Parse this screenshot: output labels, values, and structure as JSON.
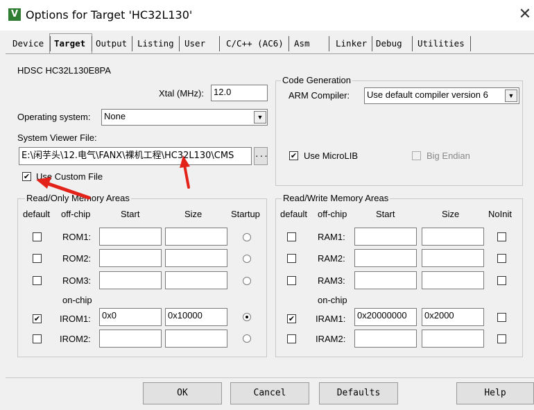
{
  "window": {
    "title": "Options for Target 'HC32L130'",
    "icon": "keil-v-icon",
    "close": "✕"
  },
  "tabs": [
    "Device",
    "Target",
    "Output",
    "Listing",
    "User",
    "C/C++ (AC6)",
    "Asm",
    "Linker",
    "Debug",
    "Utilities"
  ],
  "active_tab": "Target",
  "target": {
    "device_name": "HDSC HC32L130E8PA",
    "xtal_label": "Xtal (MHz):",
    "xtal_value": "12.0",
    "os_label": "Operating system:",
    "os_value": "None",
    "svf_label": "System Viewer File:",
    "svf_value": "E:\\闲芋头\\12.电气\\FANX\\裸机工程\\HC32L130\\CMS",
    "browse_label": "...",
    "use_custom_label": "Use Custom File",
    "use_custom_checked": true
  },
  "codegen": {
    "legend": "Code Generation",
    "compiler_label": "ARM Compiler:",
    "compiler_value": "Use default compiler version 6",
    "microlib_label": "Use MicroLIB",
    "microlib_checked": true,
    "bigendian_label": "Big Endian",
    "bigendian_checked": false
  },
  "rom": {
    "legend": "Read/Only Memory Areas",
    "headers": {
      "default": "default",
      "offchip": "off-chip",
      "start": "Start",
      "size": "Size",
      "startup": "Startup"
    },
    "onchip_label": "on-chip",
    "rows": [
      {
        "label": "ROM1:",
        "start": "",
        "size": "",
        "default": false,
        "startup": false
      },
      {
        "label": "ROM2:",
        "start": "",
        "size": "",
        "default": false,
        "startup": false
      },
      {
        "label": "ROM3:",
        "start": "",
        "size": "",
        "default": false,
        "startup": false
      },
      {
        "label": "IROM1:",
        "start": "0x0",
        "size": "0x10000",
        "default": true,
        "startup": true
      },
      {
        "label": "IROM2:",
        "start": "",
        "size": "",
        "default": false,
        "startup": false
      }
    ]
  },
  "ram": {
    "legend": "Read/Write Memory Areas",
    "headers": {
      "default": "default",
      "offchip": "off-chip",
      "start": "Start",
      "size": "Size",
      "noinit": "NoInit"
    },
    "onchip_label": "on-chip",
    "rows": [
      {
        "label": "RAM1:",
        "start": "",
        "size": "",
        "default": false,
        "noinit": false
      },
      {
        "label": "RAM2:",
        "start": "",
        "size": "",
        "default": false,
        "noinit": false
      },
      {
        "label": "RAM3:",
        "start": "",
        "size": "",
        "default": false,
        "noinit": false
      },
      {
        "label": "IRAM1:",
        "start": "0x20000000",
        "size": "0x2000",
        "default": true,
        "noinit": false
      },
      {
        "label": "IRAM2:",
        "start": "",
        "size": "",
        "default": false,
        "noinit": false
      }
    ]
  },
  "buttons": {
    "ok": "OK",
    "cancel": "Cancel",
    "defaults": "Defaults",
    "help": "Help"
  },
  "glyphs": {
    "check": "✔",
    "dropdown": "▼"
  },
  "annotation_color": "#e3231a"
}
